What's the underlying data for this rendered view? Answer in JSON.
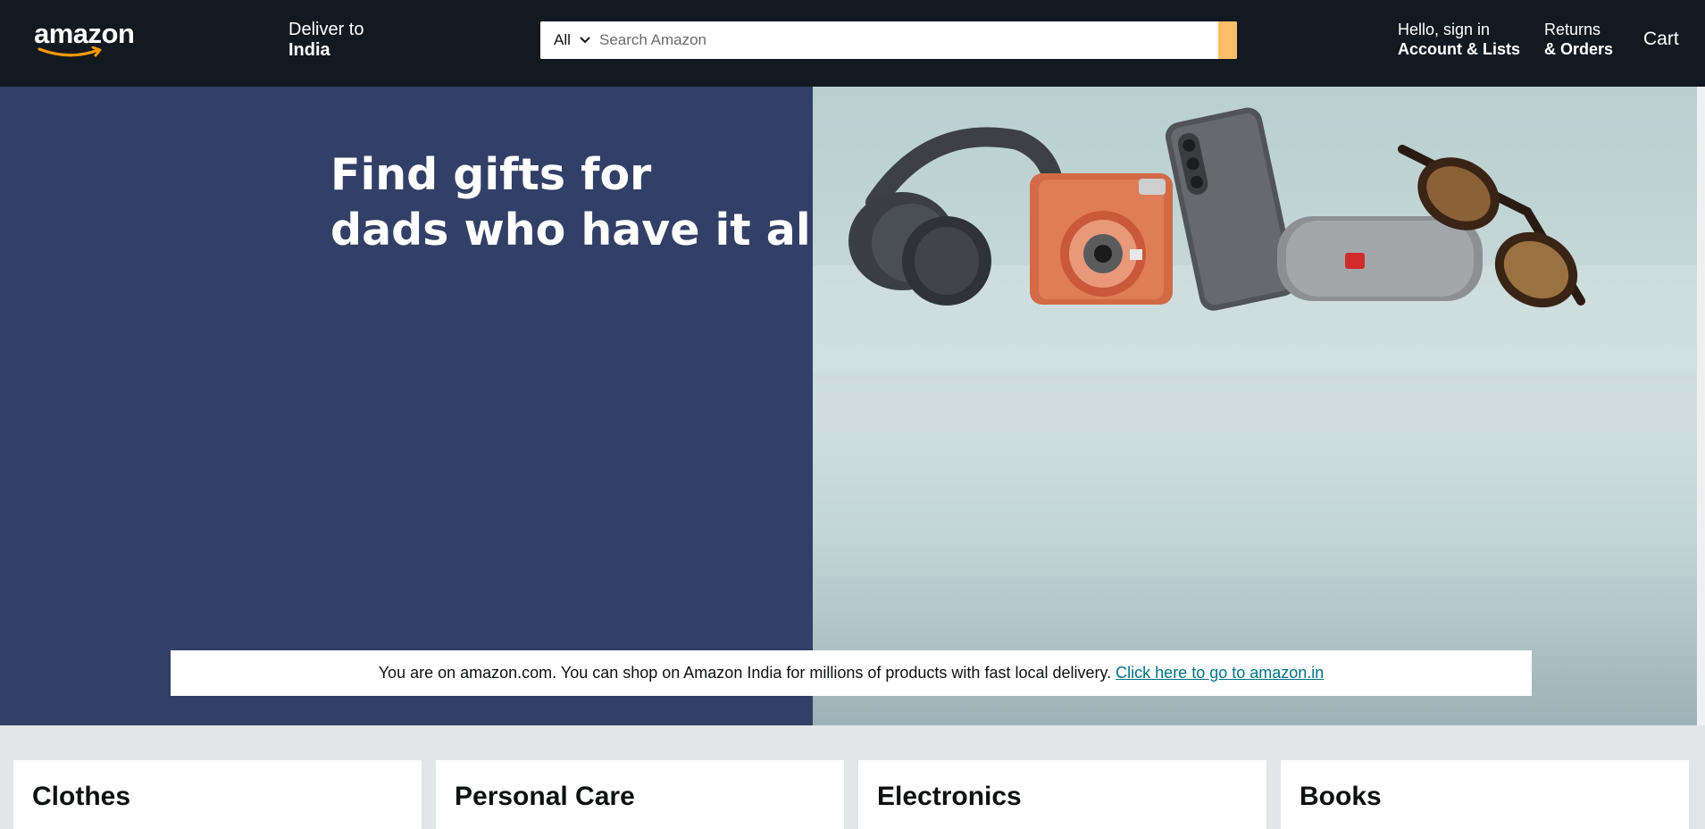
{
  "header": {
    "logo_text": "amazon",
    "deliver_line1": "Deliver to",
    "deliver_line2": "India",
    "search_category": "All",
    "search_placeholder": "Search Amazon",
    "account_line1": "Hello, sign in",
    "account_line2": "Account & Lists",
    "returns_line1": "Returns",
    "returns_line2": "& Orders",
    "cart_label": "Cart"
  },
  "hero": {
    "title_line1": "Find gifts for",
    "title_line2": "dads who have it all"
  },
  "notice": {
    "message": "You are on amazon.com. You can shop on Amazon India for millions of products with fast local delivery.",
    "link_text": "Click here to go to amazon.in"
  },
  "categories": [
    {
      "label": "Clothes"
    },
    {
      "label": "Personal Care"
    },
    {
      "label": "Electronics"
    },
    {
      "label": "Books"
    }
  ],
  "colors": {
    "header_bg": "#131921",
    "hero_left_bg": "#323f66",
    "search_button": "#febd69",
    "link": "#007185",
    "page_bg": "#e3e6e6"
  }
}
